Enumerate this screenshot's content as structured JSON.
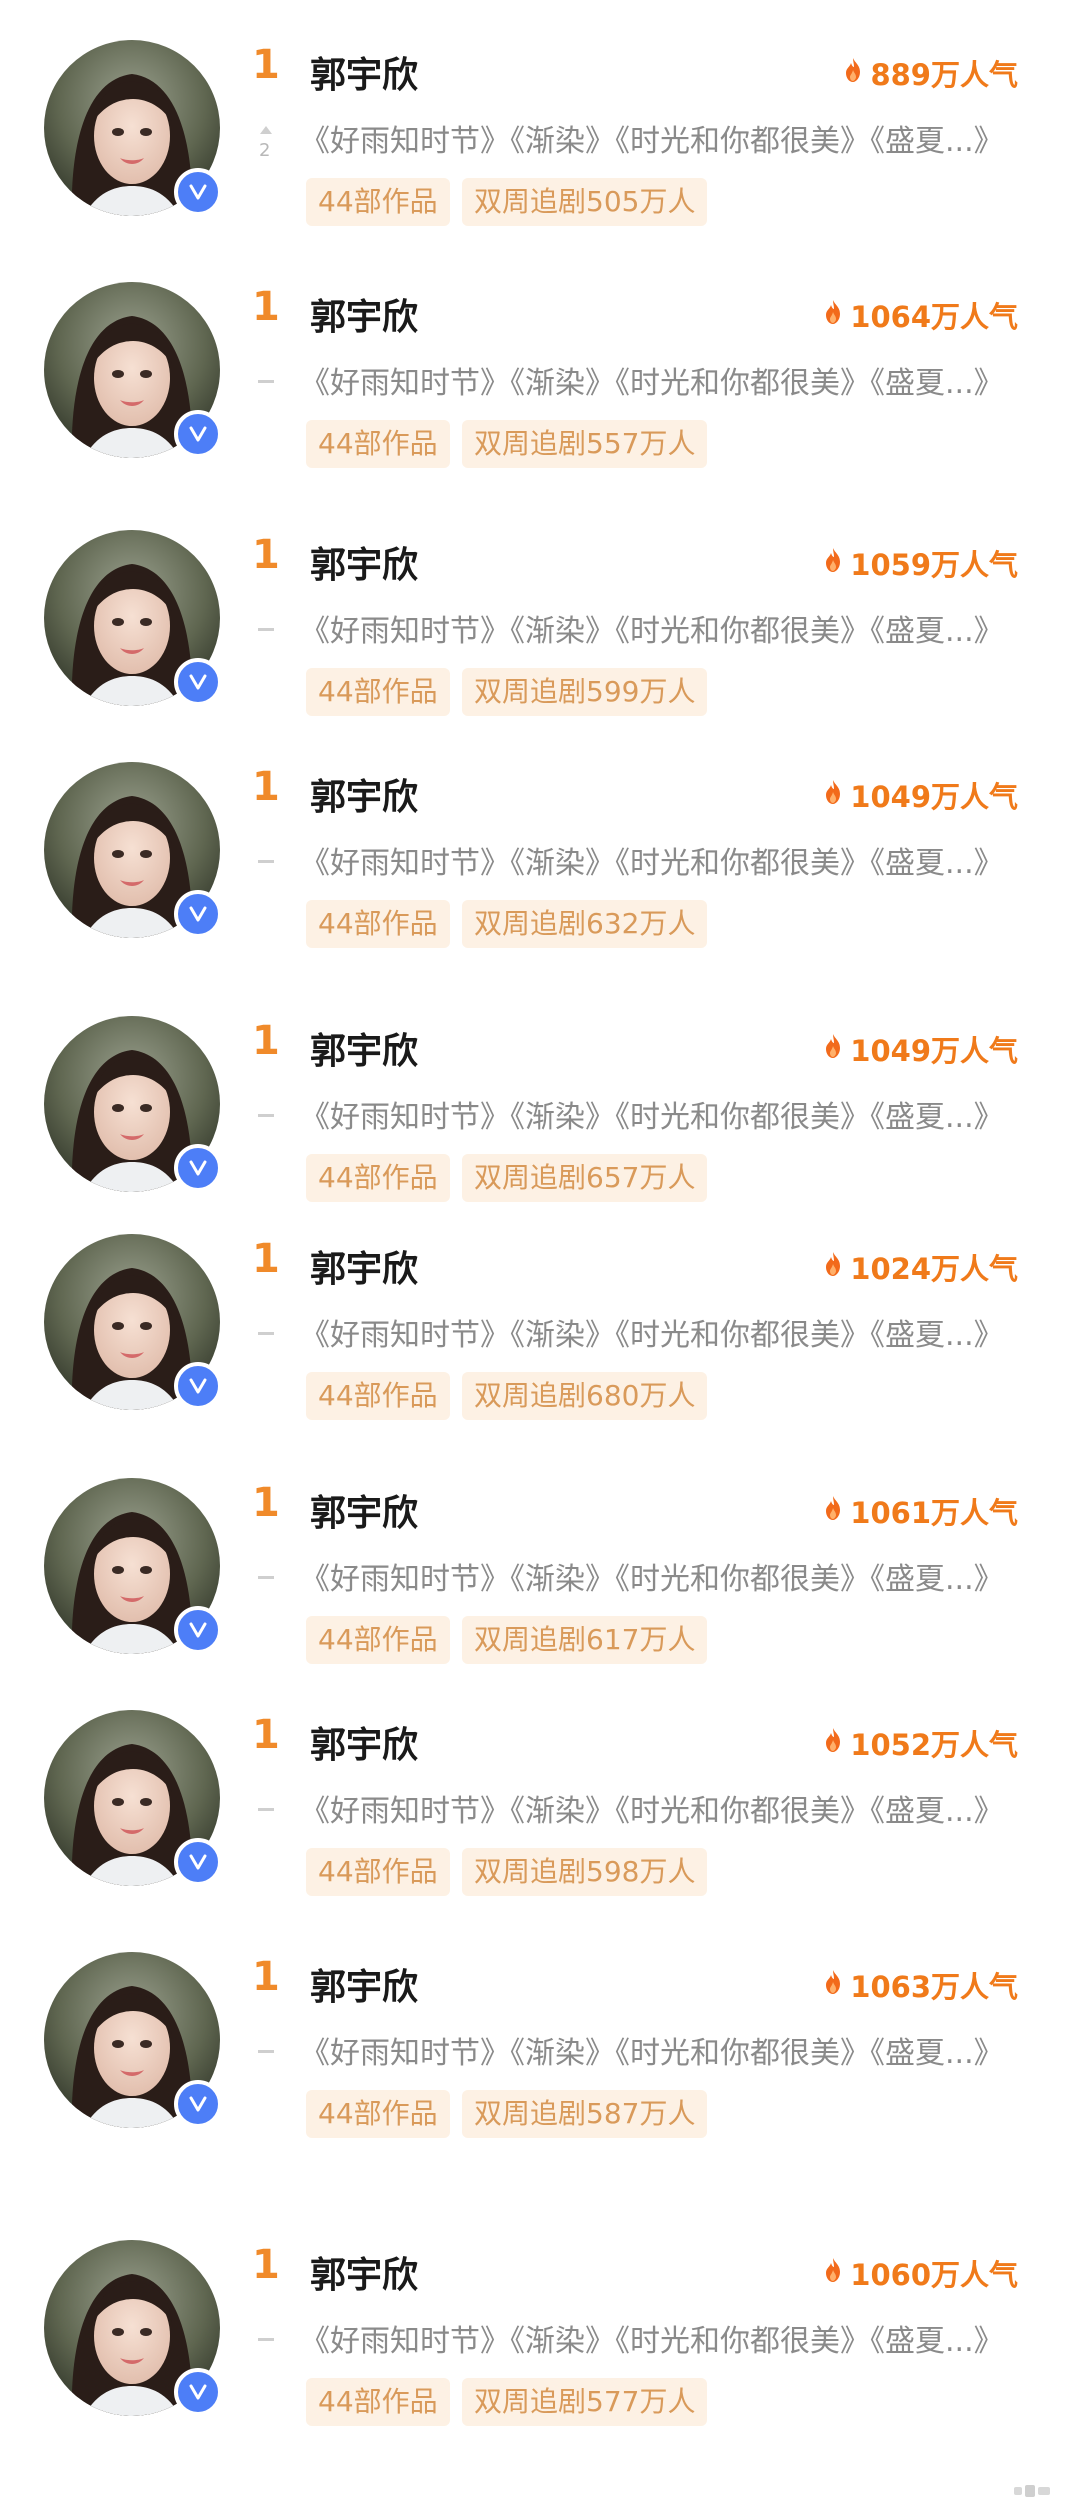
{
  "entries": [
    {
      "rank": "1",
      "name": "郭宇欣",
      "popularity": "889万人气",
      "trend": "up",
      "trend_value": "2",
      "works": "《好雨知时节》《渐染》《时光和你都很美》《盛夏...》",
      "tag_works": "44部作品",
      "tag_drama": "双周追剧505万人"
    },
    {
      "rank": "1",
      "name": "郭宇欣",
      "popularity": "1064万人气",
      "trend": "same",
      "trend_value": "",
      "works": "《好雨知时节》《渐染》《时光和你都很美》《盛夏...》",
      "tag_works": "44部作品",
      "tag_drama": "双周追剧557万人"
    },
    {
      "rank": "1",
      "name": "郭宇欣",
      "popularity": "1059万人气",
      "trend": "same",
      "trend_value": "",
      "works": "《好雨知时节》《渐染》《时光和你都很美》《盛夏...》",
      "tag_works": "44部作品",
      "tag_drama": "双周追剧599万人"
    },
    {
      "rank": "1",
      "name": "郭宇欣",
      "popularity": "1049万人气",
      "trend": "same",
      "trend_value": "",
      "works": "《好雨知时节》《渐染》《时光和你都很美》《盛夏...》",
      "tag_works": "44部作品",
      "tag_drama": "双周追剧632万人"
    },
    {
      "rank": "1",
      "name": "郭宇欣",
      "popularity": "1049万人气",
      "trend": "same",
      "trend_value": "",
      "works": "《好雨知时节》《渐染》《时光和你都很美》《盛夏...》",
      "tag_works": "44部作品",
      "tag_drama": "双周追剧657万人"
    },
    {
      "rank": "1",
      "name": "郭宇欣",
      "popularity": "1024万人气",
      "trend": "same",
      "trend_value": "",
      "works": "《好雨知时节》《渐染》《时光和你都很美》《盛夏...》",
      "tag_works": "44部作品",
      "tag_drama": "双周追剧680万人"
    },
    {
      "rank": "1",
      "name": "郭宇欣",
      "popularity": "1061万人气",
      "trend": "same",
      "trend_value": "",
      "works": "《好雨知时节》《渐染》《时光和你都很美》《盛夏...》",
      "tag_works": "44部作品",
      "tag_drama": "双周追剧617万人"
    },
    {
      "rank": "1",
      "name": "郭宇欣",
      "popularity": "1052万人气",
      "trend": "same",
      "trend_value": "",
      "works": "《好雨知时节》《渐染》《时光和你都很美》《盛夏...》",
      "tag_works": "44部作品",
      "tag_drama": "双周追剧598万人"
    },
    {
      "rank": "1",
      "name": "郭宇欣",
      "popularity": "1063万人气",
      "trend": "same",
      "trend_value": "",
      "works": "《好雨知时节》《渐染》《时光和你都很美》《盛夏...》",
      "tag_works": "44部作品",
      "tag_drama": "双周追剧587万人"
    },
    {
      "rank": "1",
      "name": "郭宇欣",
      "popularity": "1060万人气",
      "trend": "same",
      "trend_value": "",
      "works": "《好雨知时节》《渐染》《时光和你都很美》《盛夏...》",
      "tag_works": "44部作品",
      "tag_drama": "双周追剧577万人"
    }
  ],
  "colors": {
    "rank": "#f08a2a",
    "popularity": "#f07a1a",
    "verified_badge": "#4d7ef7",
    "tag_bg": "#fdf1e4",
    "tag_text": "#d99a5a"
  },
  "icons": {
    "popularity": "flame-icon",
    "verified": "verified-v-icon",
    "trend_up": "up-triangle-icon"
  }
}
